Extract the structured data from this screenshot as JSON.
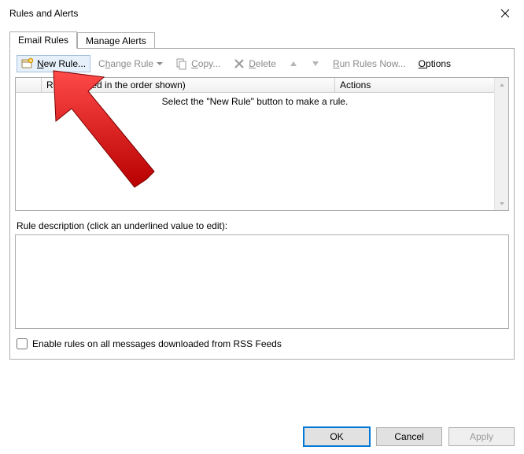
{
  "dialog": {
    "title": "Rules and Alerts"
  },
  "tabs": {
    "email_rules": "Email Rules",
    "manage_alerts": "Manage Alerts"
  },
  "toolbar": {
    "new_rule": "New Rule...",
    "change_rule": "Change Rule",
    "copy": "Copy...",
    "delete": "Delete",
    "run_rules_now": "Run Rules Now...",
    "options": "Options"
  },
  "rules_list": {
    "col_rule": "Rule (applied in the order shown)",
    "col_actions": "Actions",
    "empty_text": "Select the \"New Rule\" button to make a rule."
  },
  "description": {
    "label": "Rule description (click an underlined value to edit):"
  },
  "rss_checkbox": {
    "label": "Enable rules on all messages downloaded from RSS Feeds",
    "checked": false
  },
  "footer": {
    "ok": "OK",
    "cancel": "Cancel",
    "apply": "Apply"
  }
}
